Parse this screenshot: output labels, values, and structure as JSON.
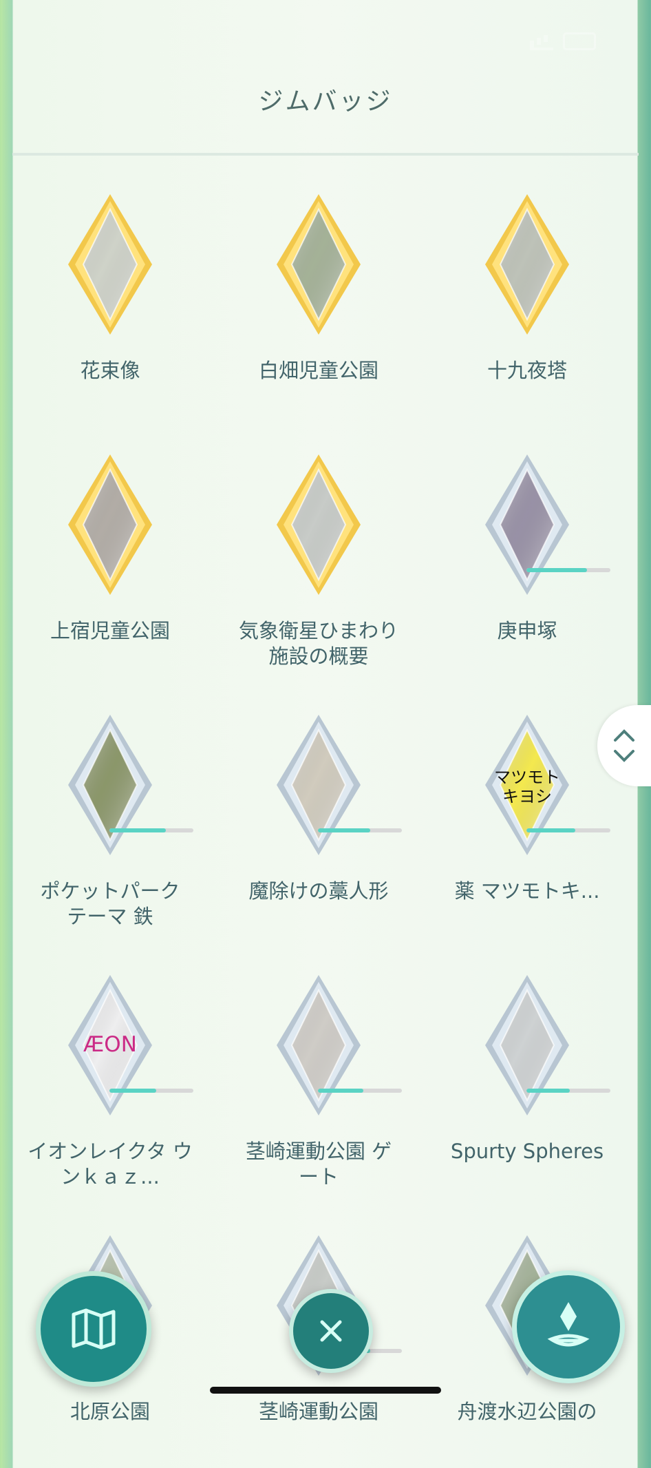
{
  "screen": {
    "title": "ジムバッジ"
  },
  "badges": [
    {
      "name": "花束像",
      "tier": "gold",
      "style": "statue",
      "progress": null
    },
    {
      "name": "白畑児童公園",
      "tier": "gold",
      "style": "green",
      "progress": null
    },
    {
      "name": "十九夜塔",
      "tier": "gold",
      "style": "stone",
      "progress": null
    },
    {
      "name": "上宿児童公園",
      "tier": "gold",
      "style": "gate",
      "progress": null
    },
    {
      "name": "気象衛星ひまわり 施設の概要",
      "tier": "gold",
      "style": "building",
      "progress": null
    },
    {
      "name": "庚申塚",
      "tier": "silver",
      "style": "purple",
      "progress": 0.72
    },
    {
      "name": "ポケットパーク テーマ 鉄",
      "tier": "silver",
      "style": "plant",
      "progress": 0.67
    },
    {
      "name": "魔除けの藁人形",
      "tier": "silver",
      "style": "sign",
      "progress": 0.62
    },
    {
      "name": "薬 マツモトキ...",
      "tier": "silver",
      "style": "yellow",
      "progress": 0.58
    },
    {
      "name": "イオンレイクタ ウンｋａｚ...",
      "tier": "silver",
      "style": "aeon",
      "progress": 0.56
    },
    {
      "name": "茎崎運動公園 ゲート",
      "tier": "silver",
      "style": "gate2",
      "progress": 0.54
    },
    {
      "name": "Spurty Spheres",
      "tier": "silver",
      "style": "glass",
      "progress": 0.52
    },
    {
      "name": "北原公園",
      "tier": "silver",
      "style": "park",
      "progress": null
    },
    {
      "name": "茎崎運動公園",
      "tier": "silver",
      "style": "building",
      "progress": 0.62
    },
    {
      "name": "舟渡水辺公園の",
      "tier": "silver",
      "style": "water",
      "progress": 0.38
    }
  ],
  "controls": {
    "map_icon": "map-icon",
    "close_icon": "close-icon",
    "ar_icon": "ar-icon",
    "scroll_icon": "scroll-up-down-icon"
  },
  "colors": {
    "gold": "#f2c84b",
    "silver": "#b8c6d2",
    "progress": "#5ad3c4",
    "button": "#1f8b87"
  }
}
